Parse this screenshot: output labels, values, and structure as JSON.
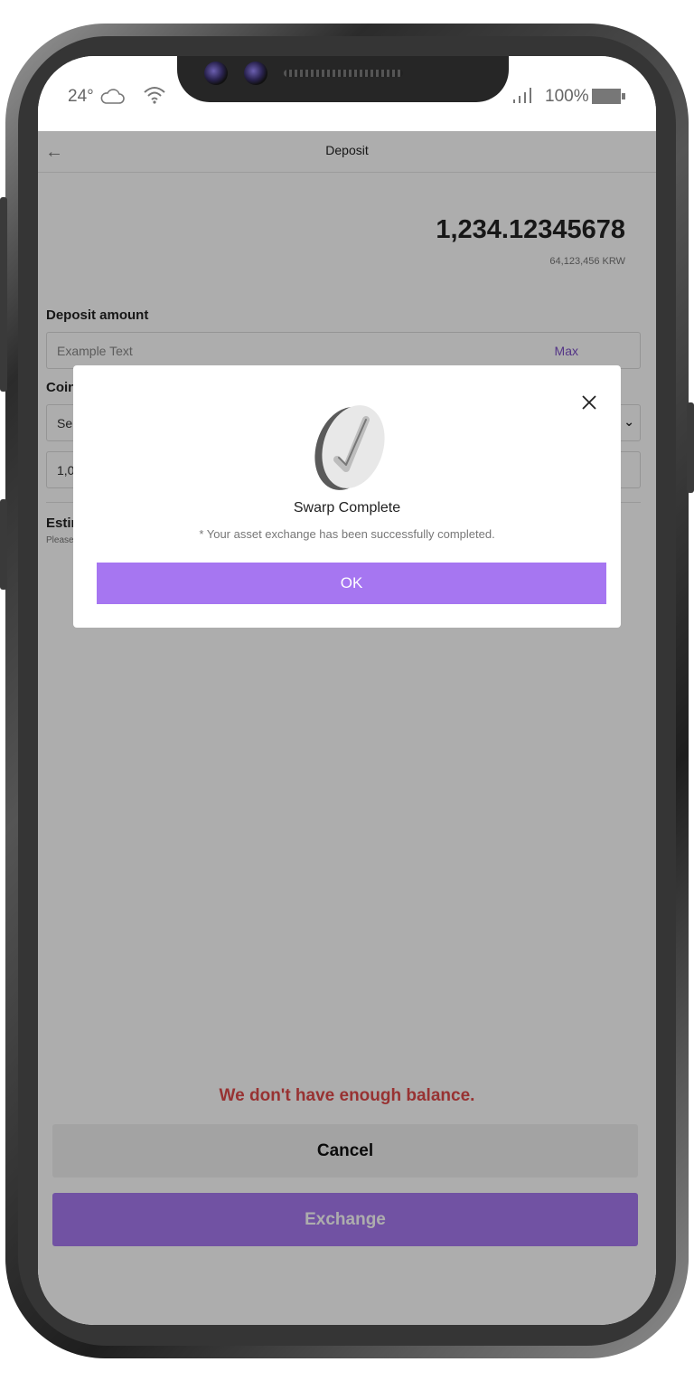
{
  "status_bar": {
    "temperature": "24°",
    "battery": "100%",
    "icons": [
      "cloud-icon",
      "wifi-icon",
      "signal-icon",
      "battery-icon"
    ]
  },
  "header": {
    "title": "Deposit",
    "back_icon": "back-arrow-icon"
  },
  "balance": {
    "amount": "1,234.12345678",
    "fiat": "64,123,456 KRW"
  },
  "deposit": {
    "label": "Deposit amount",
    "placeholder": "Example Text",
    "max_label": "Max"
  },
  "coin": {
    "label": "Coin",
    "select_partial": "Se",
    "amount_partial": "1,0"
  },
  "estimate": {
    "label_partial": "Estir",
    "note_partial": "Please"
  },
  "footer": {
    "warning": "We don't have enough balance.",
    "cancel_label": "Cancel",
    "exchange_label": "Exchange"
  },
  "modal": {
    "title": "Swarp Complete",
    "description": "* Your asset exchange has been successfully completed.",
    "ok_label": "OK"
  },
  "colors": {
    "accent": "#a779f0",
    "warning": "#e04b4b"
  }
}
